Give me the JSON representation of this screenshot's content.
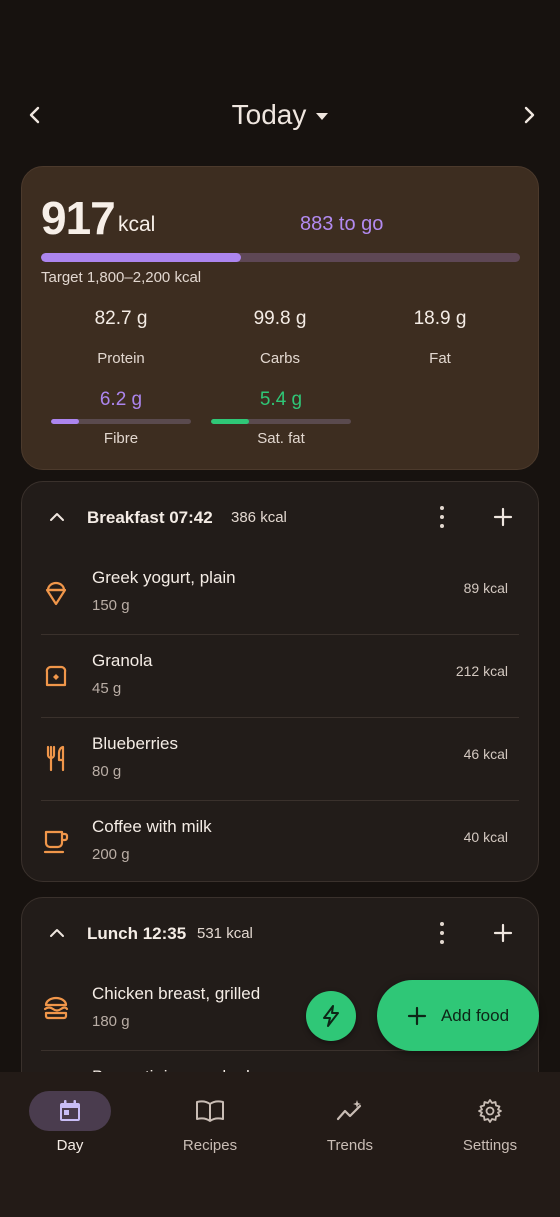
{
  "header": {
    "title": "Today"
  },
  "summary": {
    "kcal": "917",
    "kcal_unit": "kcal",
    "to_go": "883 to go",
    "progress": 0.417,
    "target": "Target 1,800–2,200 kcal",
    "macros": [
      {
        "value": "82.7 g",
        "label": "Protein"
      },
      {
        "value": "99.8 g",
        "label": "Carbs"
      },
      {
        "value": "18.9 g",
        "label": "Fat"
      }
    ],
    "minis": [
      {
        "value": "6.2 g",
        "label": "Fibre",
        "progress": 0.2,
        "color": "#ac85ee"
      },
      {
        "value": "5.4 g",
        "label": "Sat. fat",
        "progress": 0.27,
        "color": "#2fc777"
      }
    ]
  },
  "meals": [
    {
      "name": "Breakfast 07:42",
      "kcal": "386 kcal",
      "items": [
        {
          "name": "Greek yogurt, plain",
          "amount": "150 g",
          "kcal": "89 kcal",
          "icon": "ice-cream-icon"
        },
        {
          "name": "Granola",
          "amount": "45 g",
          "kcal": "212 kcal",
          "icon": "bread-icon"
        },
        {
          "name": "Blueberries",
          "amount": "80 g",
          "kcal": "46 kcal",
          "icon": "utensils-icon"
        },
        {
          "name": "Coffee with milk",
          "amount": "200 g",
          "kcal": "40 kcal",
          "icon": "coffee-icon"
        }
      ]
    },
    {
      "name": "Lunch 12:35",
      "kcal": "531 kcal",
      "items": [
        {
          "name": "Chicken breast, grilled",
          "amount": "180 g",
          "kcal": "",
          "icon": "burger-icon"
        },
        {
          "name": "Basmati rice, cooked",
          "amount": "",
          "kcal": "",
          "icon": ""
        }
      ]
    }
  ],
  "fab": {
    "add_food": "Add food"
  },
  "nav": [
    {
      "label": "Day",
      "icon": "calendar-icon",
      "active": true
    },
    {
      "label": "Recipes",
      "icon": "book-icon",
      "active": false
    },
    {
      "label": "Trends",
      "icon": "trends-icon",
      "active": false
    },
    {
      "label": "Settings",
      "icon": "gear-icon",
      "active": false
    }
  ],
  "colors": {
    "accent_purple": "#ac85ee",
    "accent_green": "#2fc777",
    "icon_orange": "#f0964a"
  }
}
